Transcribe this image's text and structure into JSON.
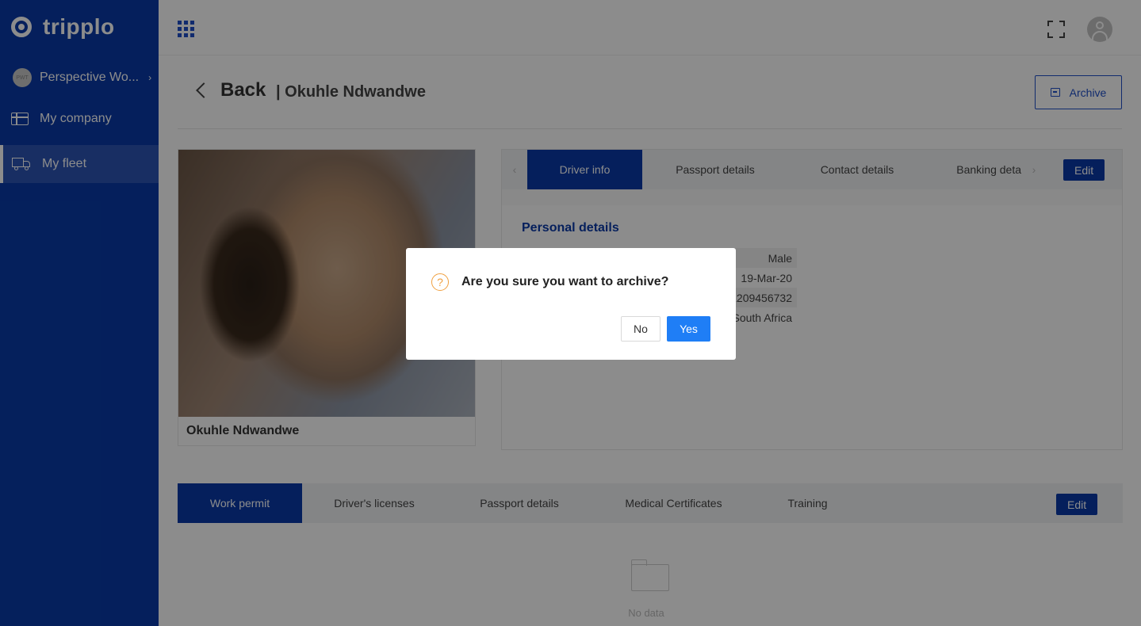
{
  "app": {
    "brand": "tripplo"
  },
  "sidebar": {
    "org": {
      "avatar_text": "PWT",
      "label": "Perspective Wo..."
    },
    "items": [
      {
        "label": "My company",
        "icon": "company-icon"
      },
      {
        "label": "My fleet",
        "icon": "truck-icon",
        "active": true
      }
    ]
  },
  "header": {
    "back_label": "Back",
    "crumb": "| Okuhle Ndwandwe",
    "archive_label": "Archive"
  },
  "profile": {
    "name": "Okuhle Ndwandwe"
  },
  "info_tabs": {
    "items": [
      "Driver info",
      "Passport details",
      "Contact details",
      "Banking deta"
    ],
    "active": "Driver info",
    "edit_label": "Edit"
  },
  "personal": {
    "title": "Personal details",
    "values": [
      "Male",
      "19-Mar-20",
      "1209456732",
      "South Africa"
    ]
  },
  "doc_tabs": {
    "items": [
      "Work permit",
      "Driver's licenses",
      "Passport details",
      "Medical Certificates",
      "Training"
    ],
    "active": "Work permit",
    "edit_label": "Edit"
  },
  "empty_state": {
    "text": "No data"
  },
  "modal": {
    "question": "Are you sure you want to archive?",
    "no_label": "No",
    "yes_label": "Yes"
  },
  "colors": {
    "sidebar": "#0a3aa8",
    "primary": "#1f7ef6",
    "warning": "#f0a040"
  }
}
